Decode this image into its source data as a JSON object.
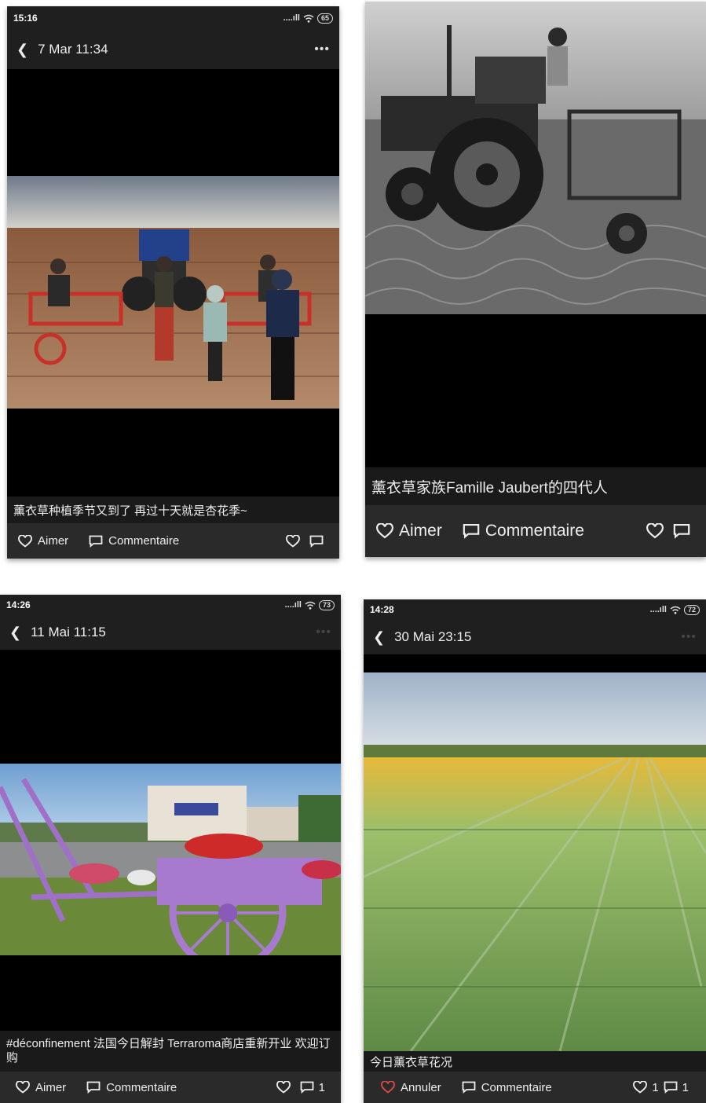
{
  "panels": [
    {
      "status": {
        "time": "15:16",
        "signal": "....ıll",
        "battery": "65"
      },
      "nav": {
        "date": "7 Mar 11:34"
      },
      "photo": {
        "description": "family-with-tractor-in-field"
      },
      "caption": "薰衣草种植季节又到了 再过十天就是杏花季~",
      "actions": {
        "like": "Aimer",
        "comment": "Commentaire",
        "like_count": "",
        "comment_count": ""
      }
    },
    {
      "photo": {
        "description": "vintage-tractor-black-white"
      },
      "caption": "薰衣草家族Famille Jaubert的四代人",
      "actions": {
        "like": "Aimer",
        "comment": "Commentaire",
        "like_count": "",
        "comment_count": ""
      }
    },
    {
      "status": {
        "time": "14:26",
        "signal": "....ıll",
        "battery": "73"
      },
      "nav": {
        "date": "11 Mai 11:15"
      },
      "photo": {
        "description": "purple-cart-with-flowers-in-front-of-shop"
      },
      "caption": "#déconfinement 法国今日解封 Terraroma商店重新开业 欢迎订购",
      "actions": {
        "like": "Aimer",
        "comment": "Commentaire",
        "like_count": "",
        "comment_count": "1"
      }
    },
    {
      "status": {
        "time": "14:28",
        "signal": "....ıll",
        "battery": "72"
      },
      "nav": {
        "date": "30 Mai 23:15"
      },
      "photo": {
        "description": "lavender-field-rows"
      },
      "caption": "今日薰衣草花况",
      "actions": {
        "like": "Annuler",
        "comment": "Commentaire",
        "like_count": "1",
        "comment_count": "1"
      }
    }
  ],
  "colors": {
    "liked_heart": "#e04848",
    "bar_bg": "#2a2a2a",
    "header_bg": "#1f1f1f"
  }
}
